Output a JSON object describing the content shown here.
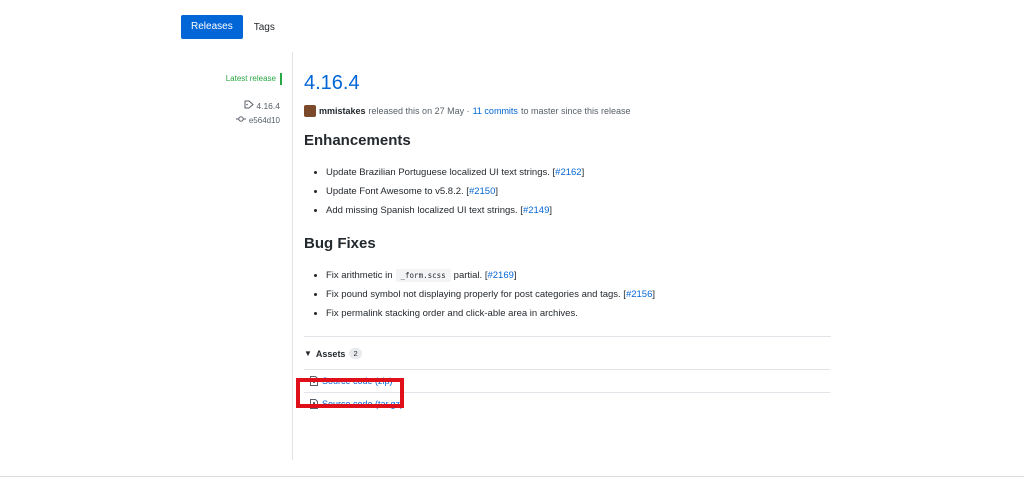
{
  "tabs": {
    "releases": "Releases",
    "tags": "Tags"
  },
  "meta": {
    "latest_release": "Latest release",
    "tag": "4.16.4",
    "commit": "e564d10"
  },
  "release": {
    "title": "4.16.4",
    "author": "mmistakes",
    "released_text": "released this on 27 May ·",
    "commits_link": "11 commits",
    "since_text": "to master since this release"
  },
  "enhancements": {
    "heading": "Enhancements",
    "items": [
      {
        "text": "Update Brazilian Portuguese localized UI text strings.",
        "ref": "#2162"
      },
      {
        "text": "Update Font Awesome to v5.8.2.",
        "ref": "#2150"
      },
      {
        "text": "Add missing Spanish localized UI text strings.",
        "ref": "#2149"
      }
    ]
  },
  "bug_fixes": {
    "heading": "Bug Fixes",
    "items": [
      {
        "pre": "Fix arithmetic in",
        "code": "_form.scss",
        "post": "partial.",
        "ref": "#2169"
      },
      {
        "text": "Fix pound symbol not displaying properly for post categories and tags.",
        "ref": "#2156"
      },
      {
        "text": "Fix permalink stacking order and click-able area in archives."
      }
    ]
  },
  "assets": {
    "heading": "Assets",
    "count": "2",
    "items": [
      {
        "label": "Source code (zip)"
      },
      {
        "label": "Source code (tar.gz)"
      }
    ]
  },
  "colors": {
    "link": "#0366d6",
    "latest": "#28a745",
    "highlight": "#e0101b"
  }
}
